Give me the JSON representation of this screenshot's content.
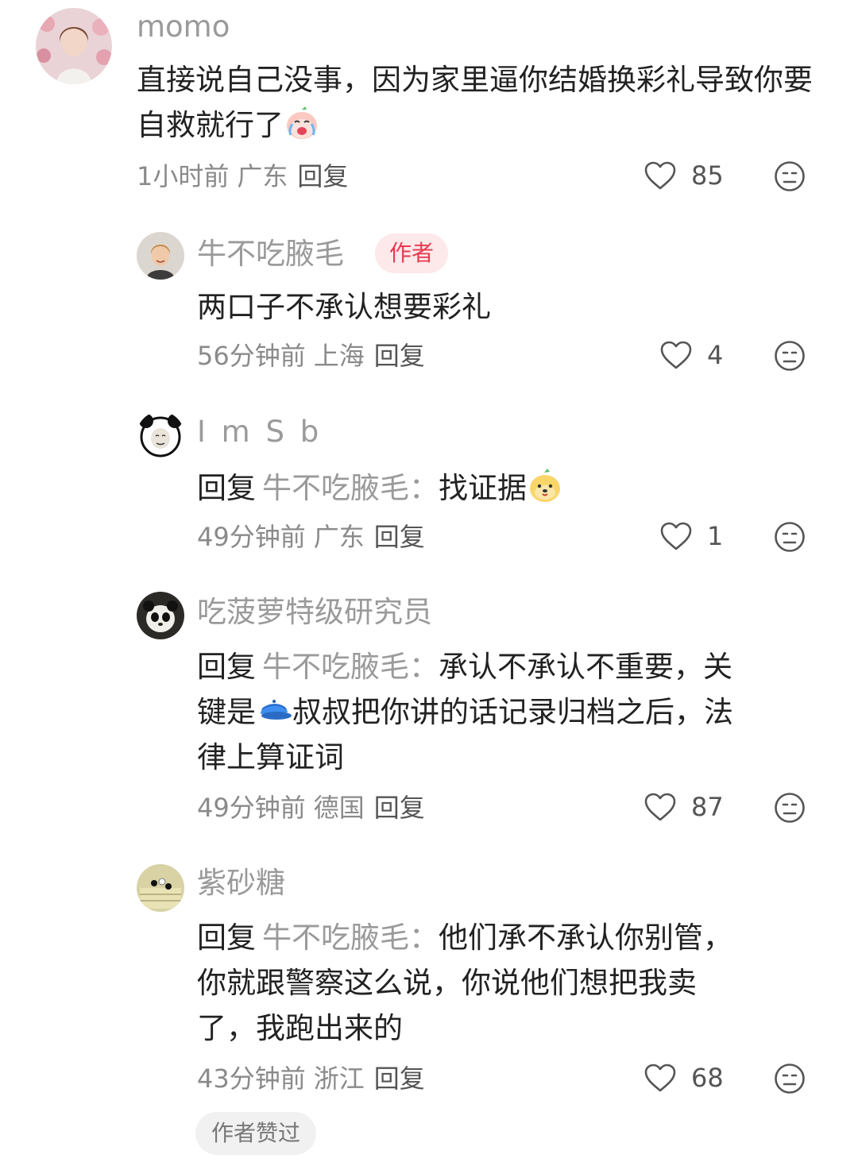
{
  "comments": [
    {
      "username": "momo",
      "content": "直接说自己没事，因为家里逼你结婚换彩礼导致你要自救就行了",
      "time": "1小时前",
      "location": "广东",
      "reply_label": "回复",
      "likes": "85",
      "avatar_icon": "avatar-girl-flowers"
    },
    {
      "username": "牛不吃腋毛",
      "badge": "作者",
      "content": "两口子不承认想要彩礼",
      "time": "56分钟前",
      "location": "上海",
      "reply_label": "回复",
      "likes": "4",
      "avatar_icon": "avatar-girl-smile"
    },
    {
      "username": "I m S b",
      "reply_prefix": "回复",
      "reply_target": "牛不吃腋毛",
      "colon": "：",
      "content": "找证据",
      "time": "49分钟前",
      "location": "广东",
      "reply_label": "回复",
      "likes": "1",
      "avatar_icon": "avatar-panda-meme"
    },
    {
      "username": "吃菠萝特级研究员",
      "reply_prefix": "回复",
      "reply_target": "牛不吃腋毛",
      "colon": "：",
      "content_line1": "承认不承认不重要，关",
      "content_line2a": "键是",
      "content_line2b": "叔叔把你讲的话记录归档之后，法",
      "content_line3": "律上算证词",
      "time": "49分钟前",
      "location": "德国",
      "reply_label": "回复",
      "likes": "87",
      "avatar_icon": "avatar-panda"
    },
    {
      "username": "紫砂糖",
      "reply_prefix": "回复",
      "reply_target": "牛不吃腋毛",
      "colon": "：",
      "content_line1": "他们承不承认你别管，",
      "content_line2": "你就跟警察这么说，你说他们想把我卖",
      "content_line3": "了，我跑出来的",
      "time": "43分钟前",
      "location": "浙江",
      "reply_label": "回复",
      "likes": "68",
      "avatar_icon": "avatar-go-board",
      "liked_by_author": "作者赞过"
    }
  ],
  "colors": {
    "username": "#9a9a9a",
    "badge_bg": "#fde8ea",
    "badge_text": "#e8384f",
    "meta": "#8a8a8a"
  }
}
